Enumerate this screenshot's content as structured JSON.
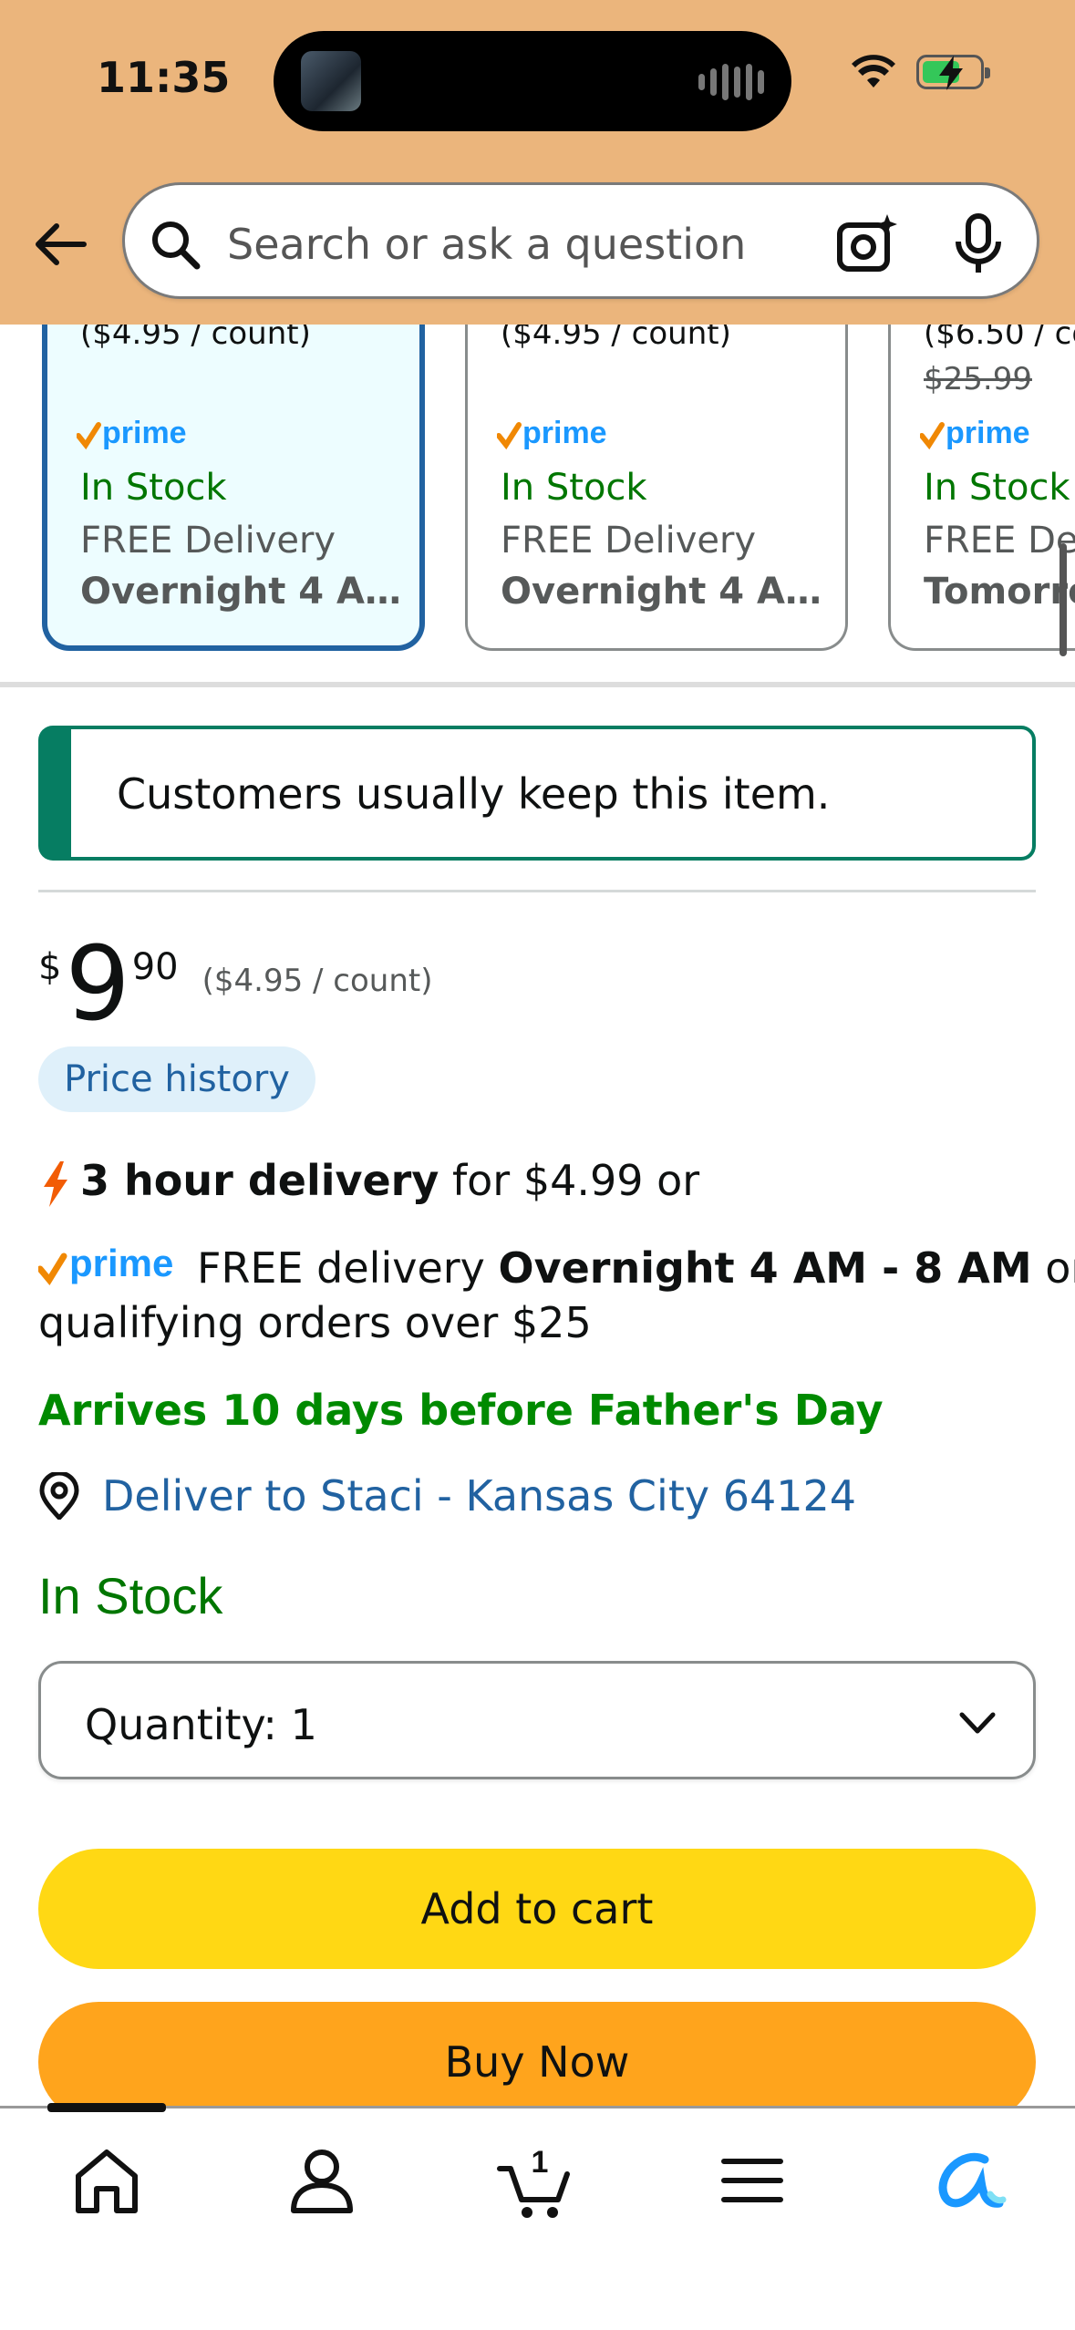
{
  "status_bar": {
    "time": "11:35"
  },
  "search": {
    "placeholder": "Search or ask a question"
  },
  "offers": [
    {
      "price_per_count": "($4.95 / count)",
      "list_price": "",
      "availability": "In Stock",
      "delivery_label": "FREE Delivery",
      "delivery_time": "Overnight 4 A…",
      "selected": true
    },
    {
      "price_per_count": "($4.95 / count)",
      "list_price": "",
      "availability": "In Stock",
      "delivery_label": "FREE Delivery",
      "delivery_time": "Overnight 4 A…",
      "selected": false
    },
    {
      "price_per_count": "($6.50 / co",
      "list_price": "$25.99",
      "availability": "In Stock",
      "delivery_label": "FREE Del",
      "delivery_time": "Tomorro",
      "selected": false
    }
  ],
  "prime_label": "prime",
  "keep_banner": "Customers usually keep this item.",
  "price": {
    "currency": "$",
    "whole": "9",
    "fraction": "90",
    "per_unit": "($4.95 / count)"
  },
  "price_history_label": "Price history",
  "fast_delivery": {
    "bold": "3 hour delivery",
    "rest": " for $4.99 or"
  },
  "prime_delivery": {
    "pre": "FREE delivery ",
    "bold": "Overnight 4 AM - 8 AM",
    "post": " on",
    "line2": "qualifying orders over $25"
  },
  "arrival_message": "Arrives 10 days before Father's Day",
  "deliver_to": "Deliver to Staci - Kansas City 64124",
  "availability": "In Stock",
  "quantity": {
    "label": "Quantity:",
    "value": "1"
  },
  "buttons": {
    "add_to_cart": "Add to cart",
    "buy_now": "Buy Now"
  },
  "nav": {
    "cart_count": "1"
  },
  "colors": {
    "header": "#ebb57c",
    "add_to_cart": "#ffd814",
    "buy_now": "#ffa41c",
    "link": "#2162a1",
    "in_stock": "#007600",
    "prime_blue": "#1a98ff",
    "prime_check": "#f08804"
  }
}
